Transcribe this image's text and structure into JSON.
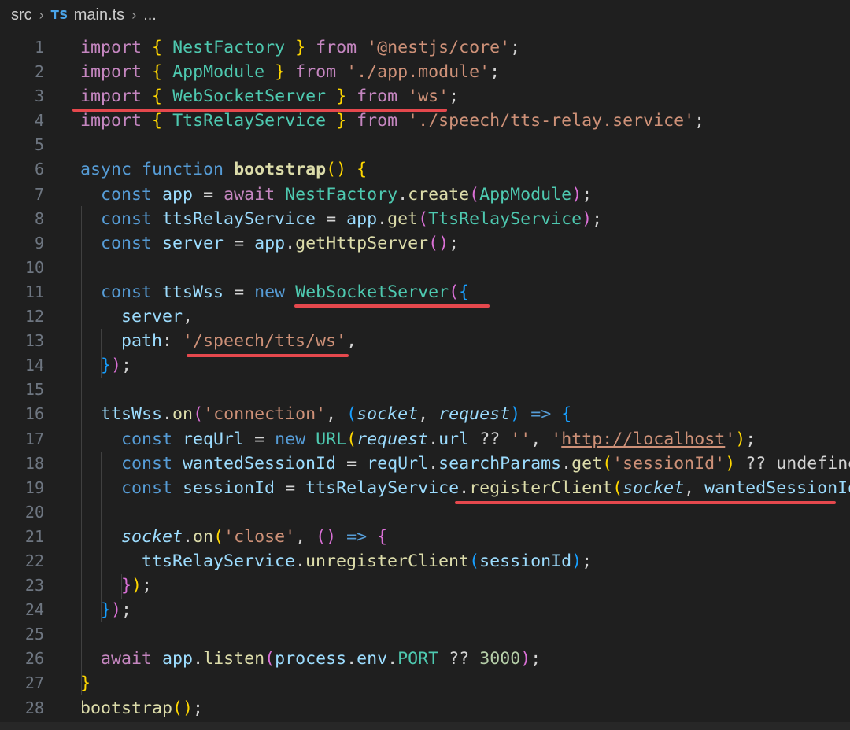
{
  "breadcrumb": {
    "folder": "src",
    "file_icon": "TS",
    "file": "main.ts",
    "more": "..."
  },
  "code": {
    "lines": [
      {
        "n": "1",
        "t": [
          [
            "k",
            "import"
          ],
          [
            "o",
            " "
          ],
          [
            "p1",
            "{"
          ],
          [
            "o",
            " "
          ],
          [
            "c",
            "NestFactory"
          ],
          [
            "o",
            " "
          ],
          [
            "p1",
            "}"
          ],
          [
            "o",
            " "
          ],
          [
            "k",
            "from"
          ],
          [
            "o",
            " "
          ],
          [
            "s",
            "'@nestjs/core'"
          ],
          [
            "o",
            ";"
          ]
        ]
      },
      {
        "n": "2",
        "t": [
          [
            "k",
            "import"
          ],
          [
            "o",
            " "
          ],
          [
            "p1",
            "{"
          ],
          [
            "o",
            " "
          ],
          [
            "c",
            "AppModule"
          ],
          [
            "o",
            " "
          ],
          [
            "p1",
            "}"
          ],
          [
            "o",
            " "
          ],
          [
            "k",
            "from"
          ],
          [
            "o",
            " "
          ],
          [
            "s",
            "'./app.module'"
          ],
          [
            "o",
            ";"
          ]
        ]
      },
      {
        "n": "3",
        "t": [
          [
            "k",
            "import"
          ],
          [
            "o",
            " "
          ],
          [
            "p1",
            "{"
          ],
          [
            "o",
            " "
          ],
          [
            "c",
            "WebSocketServer"
          ],
          [
            "o",
            " "
          ],
          [
            "p1",
            "}"
          ],
          [
            "o",
            " "
          ],
          [
            "k",
            "from"
          ],
          [
            "o",
            " "
          ],
          [
            "s",
            "'ws'"
          ],
          [
            "o",
            ";"
          ]
        ]
      },
      {
        "n": "4",
        "t": [
          [
            "k",
            "import"
          ],
          [
            "o",
            " "
          ],
          [
            "p1",
            "{"
          ],
          [
            "o",
            " "
          ],
          [
            "c",
            "TtsRelayService"
          ],
          [
            "o",
            " "
          ],
          [
            "p1",
            "}"
          ],
          [
            "o",
            " "
          ],
          [
            "k",
            "from"
          ],
          [
            "o",
            " "
          ],
          [
            "s",
            "'./speech/tts-relay.service'"
          ],
          [
            "o",
            ";"
          ]
        ]
      },
      {
        "n": "5",
        "t": []
      },
      {
        "n": "6",
        "t": [
          [
            "b",
            "async"
          ],
          [
            "o",
            " "
          ],
          [
            "b",
            "function"
          ],
          [
            "o",
            " "
          ],
          [
            "fb",
            "bootstrap"
          ],
          [
            "p1",
            "()"
          ],
          [
            "o",
            " "
          ],
          [
            "p1",
            "{"
          ]
        ]
      },
      {
        "n": "7",
        "t": [
          [
            "o",
            "  "
          ],
          [
            "b",
            "const"
          ],
          [
            "o",
            " "
          ],
          [
            "v",
            "app"
          ],
          [
            "o",
            " = "
          ],
          [
            "k",
            "await"
          ],
          [
            "o",
            " "
          ],
          [
            "c",
            "NestFactory"
          ],
          [
            "o",
            "."
          ],
          [
            "f",
            "create"
          ],
          [
            "p2",
            "("
          ],
          [
            "c",
            "AppModule"
          ],
          [
            "p2",
            ")"
          ],
          [
            "o",
            ";"
          ]
        ]
      },
      {
        "n": "8",
        "t": [
          [
            "o",
            "  "
          ],
          [
            "b",
            "const"
          ],
          [
            "o",
            " "
          ],
          [
            "v",
            "ttsRelayService"
          ],
          [
            "o",
            " = "
          ],
          [
            "v",
            "app"
          ],
          [
            "o",
            "."
          ],
          [
            "f",
            "get"
          ],
          [
            "p2",
            "("
          ],
          [
            "c",
            "TtsRelayService"
          ],
          [
            "p2",
            ")"
          ],
          [
            "o",
            ";"
          ]
        ]
      },
      {
        "n": "9",
        "t": [
          [
            "o",
            "  "
          ],
          [
            "b",
            "const"
          ],
          [
            "o",
            " "
          ],
          [
            "v",
            "server"
          ],
          [
            "o",
            " = "
          ],
          [
            "v",
            "app"
          ],
          [
            "o",
            "."
          ],
          [
            "f",
            "getHttpServer"
          ],
          [
            "p2",
            "()"
          ],
          [
            "o",
            ";"
          ]
        ]
      },
      {
        "n": "10",
        "t": []
      },
      {
        "n": "11",
        "t": [
          [
            "o",
            "  "
          ],
          [
            "b",
            "const"
          ],
          [
            "o",
            " "
          ],
          [
            "v",
            "ttsWss"
          ],
          [
            "o",
            " = "
          ],
          [
            "b",
            "new"
          ],
          [
            "o",
            " "
          ],
          [
            "c",
            "WebSocketServer"
          ],
          [
            "p2",
            "("
          ],
          [
            "p3",
            "{"
          ]
        ]
      },
      {
        "n": "12",
        "t": [
          [
            "o",
            "    "
          ],
          [
            "v",
            "server"
          ],
          [
            "o",
            ","
          ]
        ]
      },
      {
        "n": "13",
        "t": [
          [
            "o",
            "    "
          ],
          [
            "v",
            "path"
          ],
          [
            "o",
            ": "
          ],
          [
            "s",
            "'/speech/tts/ws'"
          ],
          [
            "o",
            ","
          ]
        ]
      },
      {
        "n": "14",
        "t": [
          [
            "o",
            "  "
          ],
          [
            "p3",
            "}"
          ],
          [
            "p2",
            ")"
          ],
          [
            "o",
            ";"
          ]
        ]
      },
      {
        "n": "15",
        "t": []
      },
      {
        "n": "16",
        "t": [
          [
            "o",
            "  "
          ],
          [
            "v",
            "ttsWss"
          ],
          [
            "o",
            "."
          ],
          [
            "f",
            "on"
          ],
          [
            "p2",
            "("
          ],
          [
            "s",
            "'connection'"
          ],
          [
            "o",
            ", "
          ],
          [
            "p3",
            "("
          ],
          [
            "vi",
            "socket"
          ],
          [
            "o",
            ", "
          ],
          [
            "vi",
            "request"
          ],
          [
            "p3",
            ")"
          ],
          [
            "o",
            " "
          ],
          [
            "b",
            "=>"
          ],
          [
            "o",
            " "
          ],
          [
            "p3",
            "{"
          ]
        ]
      },
      {
        "n": "17",
        "t": [
          [
            "o",
            "    "
          ],
          [
            "b",
            "const"
          ],
          [
            "o",
            " "
          ],
          [
            "v",
            "reqUrl"
          ],
          [
            "o",
            " = "
          ],
          [
            "b",
            "new"
          ],
          [
            "o",
            " "
          ],
          [
            "c",
            "URL"
          ],
          [
            "p1",
            "("
          ],
          [
            "vi",
            "request"
          ],
          [
            "o",
            "."
          ],
          [
            "v",
            "url"
          ],
          [
            "o",
            " ?? "
          ],
          [
            "s",
            "''"
          ],
          [
            "o",
            ", "
          ],
          [
            "s",
            "'"
          ],
          [
            "su",
            "http://localhost"
          ],
          [
            "s",
            "'"
          ],
          [
            "p1",
            ")"
          ],
          [
            "o",
            ";"
          ]
        ]
      },
      {
        "n": "18",
        "t": [
          [
            "o",
            "    "
          ],
          [
            "b",
            "const"
          ],
          [
            "o",
            " "
          ],
          [
            "v",
            "wantedSessionId"
          ],
          [
            "o",
            " = "
          ],
          [
            "v",
            "reqUrl"
          ],
          [
            "o",
            "."
          ],
          [
            "v",
            "searchParams"
          ],
          [
            "o",
            "."
          ],
          [
            "f",
            "get"
          ],
          [
            "p1",
            "("
          ],
          [
            "s",
            "'sessionId'"
          ],
          [
            "p1",
            ")"
          ],
          [
            "o",
            " ?? undefined;"
          ]
        ]
      },
      {
        "n": "19",
        "t": [
          [
            "o",
            "    "
          ],
          [
            "b",
            "const"
          ],
          [
            "o",
            " "
          ],
          [
            "v",
            "sessionId"
          ],
          [
            "o",
            " = "
          ],
          [
            "v",
            "ttsRelayService"
          ],
          [
            "o",
            "."
          ],
          [
            "f",
            "registerClient"
          ],
          [
            "p1",
            "("
          ],
          [
            "vi",
            "socket"
          ],
          [
            "o",
            ", "
          ],
          [
            "v",
            "wantedSessionId"
          ],
          [
            "p1",
            ")"
          ],
          [
            "o",
            ";"
          ]
        ]
      },
      {
        "n": "20",
        "t": []
      },
      {
        "n": "21",
        "t": [
          [
            "o",
            "    "
          ],
          [
            "vi",
            "socket"
          ],
          [
            "o",
            "."
          ],
          [
            "f",
            "on"
          ],
          [
            "p1",
            "("
          ],
          [
            "s",
            "'close'"
          ],
          [
            "o",
            ", "
          ],
          [
            "p2",
            "()"
          ],
          [
            "o",
            " "
          ],
          [
            "b",
            "=>"
          ],
          [
            "o",
            " "
          ],
          [
            "p2",
            "{"
          ]
        ]
      },
      {
        "n": "22",
        "t": [
          [
            "o",
            "      "
          ],
          [
            "v",
            "ttsRelayService"
          ],
          [
            "o",
            "."
          ],
          [
            "f",
            "unregisterClient"
          ],
          [
            "p3",
            "("
          ],
          [
            "v",
            "sessionId"
          ],
          [
            "p3",
            ")"
          ],
          [
            "o",
            ";"
          ]
        ]
      },
      {
        "n": "23",
        "t": [
          [
            "o",
            "    "
          ],
          [
            "p2",
            "}"
          ],
          [
            "p1",
            ")"
          ],
          [
            "o",
            ";"
          ]
        ]
      },
      {
        "n": "24",
        "t": [
          [
            "o",
            "  "
          ],
          [
            "p3",
            "}"
          ],
          [
            "p2",
            ")"
          ],
          [
            "o",
            ";"
          ]
        ]
      },
      {
        "n": "25",
        "t": []
      },
      {
        "n": "26",
        "t": [
          [
            "o",
            "  "
          ],
          [
            "k",
            "await"
          ],
          [
            "o",
            " "
          ],
          [
            "v",
            "app"
          ],
          [
            "o",
            "."
          ],
          [
            "f",
            "listen"
          ],
          [
            "p2",
            "("
          ],
          [
            "v",
            "process"
          ],
          [
            "o",
            "."
          ],
          [
            "v",
            "env"
          ],
          [
            "o",
            "."
          ],
          [
            "c",
            "PORT"
          ],
          [
            "o",
            " ?? "
          ],
          [
            "n",
            "3000"
          ],
          [
            "p2",
            ")"
          ],
          [
            "o",
            ";"
          ]
        ]
      },
      {
        "n": "27",
        "t": [
          [
            "p1",
            "}"
          ]
        ]
      },
      {
        "n": "28",
        "t": [
          [
            "f",
            "bootstrap"
          ],
          [
            "p1",
            "()"
          ],
          [
            "o",
            ";"
          ]
        ]
      }
    ]
  },
  "colors": {
    "background": "#1f1f1f",
    "annotation_underline": "#e5484d"
  }
}
